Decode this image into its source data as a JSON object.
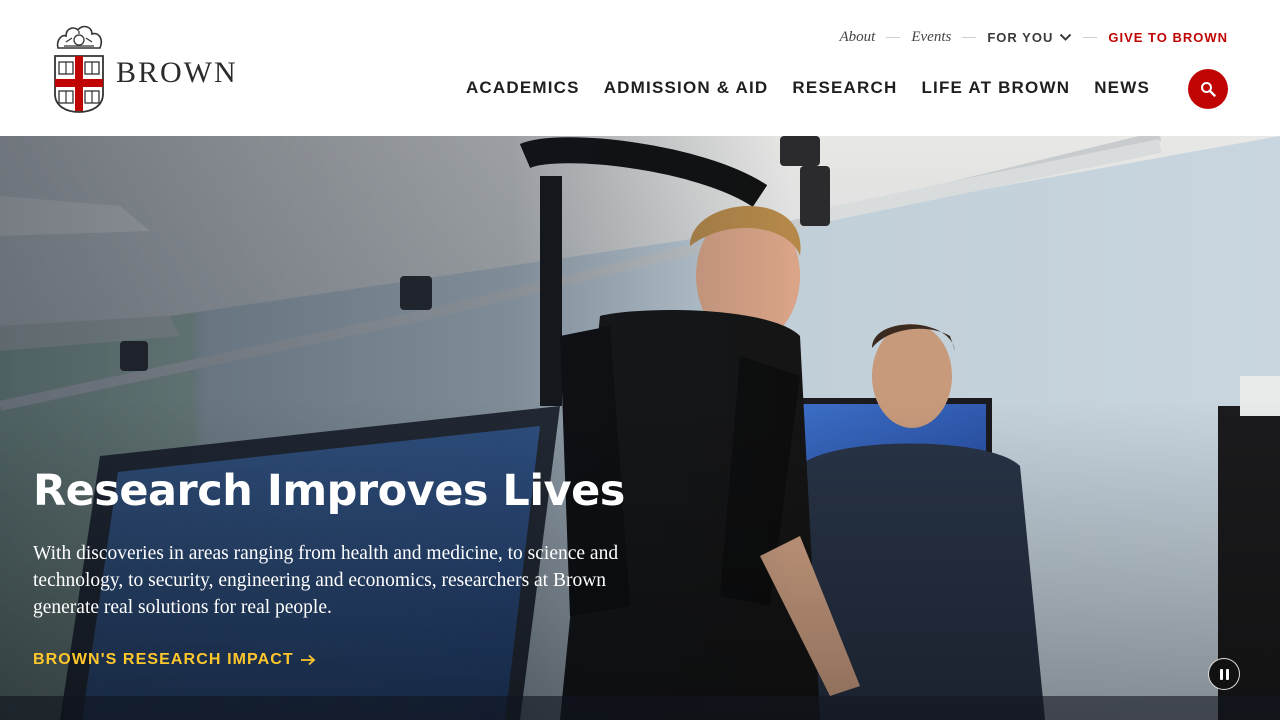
{
  "header": {
    "wordmark": "BROWN",
    "utility": {
      "about": "About",
      "events": "Events",
      "for_you": "FOR YOU",
      "give": "GIVE TO BROWN"
    },
    "nav": [
      "ACADEMICS",
      "ADMISSION & AID",
      "RESEARCH",
      "LIFE AT BROWN",
      "NEWS"
    ],
    "search_icon": "search-icon"
  },
  "hero": {
    "title": "Research Improves Lives",
    "body": "With discoveries in areas ranging from health and medicine, to science and technology, to security, engineering and economics, researchers at Brown generate real solutions for real people.",
    "cta": "BROWN'S RESEARCH IMPACT",
    "cta_icon": "arrow-right-icon",
    "pause_icon": "pause-icon"
  },
  "colors": {
    "brand_red": "#c00404",
    "cta_gold": "#ffc72c",
    "text_dark": "#1f1f1f"
  }
}
